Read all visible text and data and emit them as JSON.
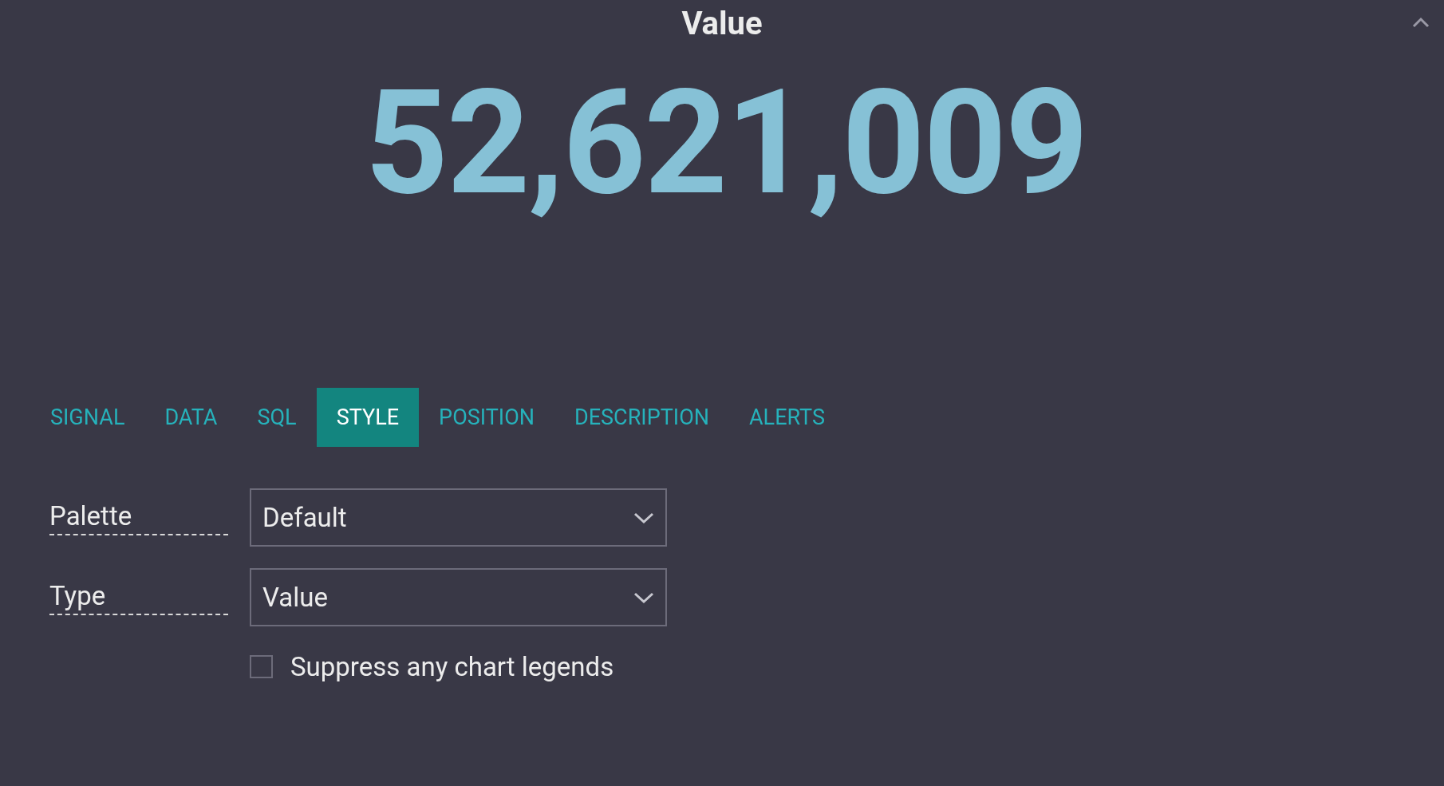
{
  "panel": {
    "title": "Value",
    "value": "52,621,009"
  },
  "tabs": [
    {
      "label": "SIGNAL",
      "selected": false
    },
    {
      "label": "DATA",
      "selected": false
    },
    {
      "label": "SQL",
      "selected": false
    },
    {
      "label": "STYLE",
      "selected": true
    },
    {
      "label": "POSITION",
      "selected": false
    },
    {
      "label": "DESCRIPTION",
      "selected": false
    },
    {
      "label": "ALERTS",
      "selected": false
    }
  ],
  "fields": [
    {
      "label": "Palette",
      "value": "Default"
    },
    {
      "label": "Type",
      "value": "Value"
    }
  ],
  "checkbox": {
    "label": "Suppress any chart legends",
    "checked": false
  }
}
